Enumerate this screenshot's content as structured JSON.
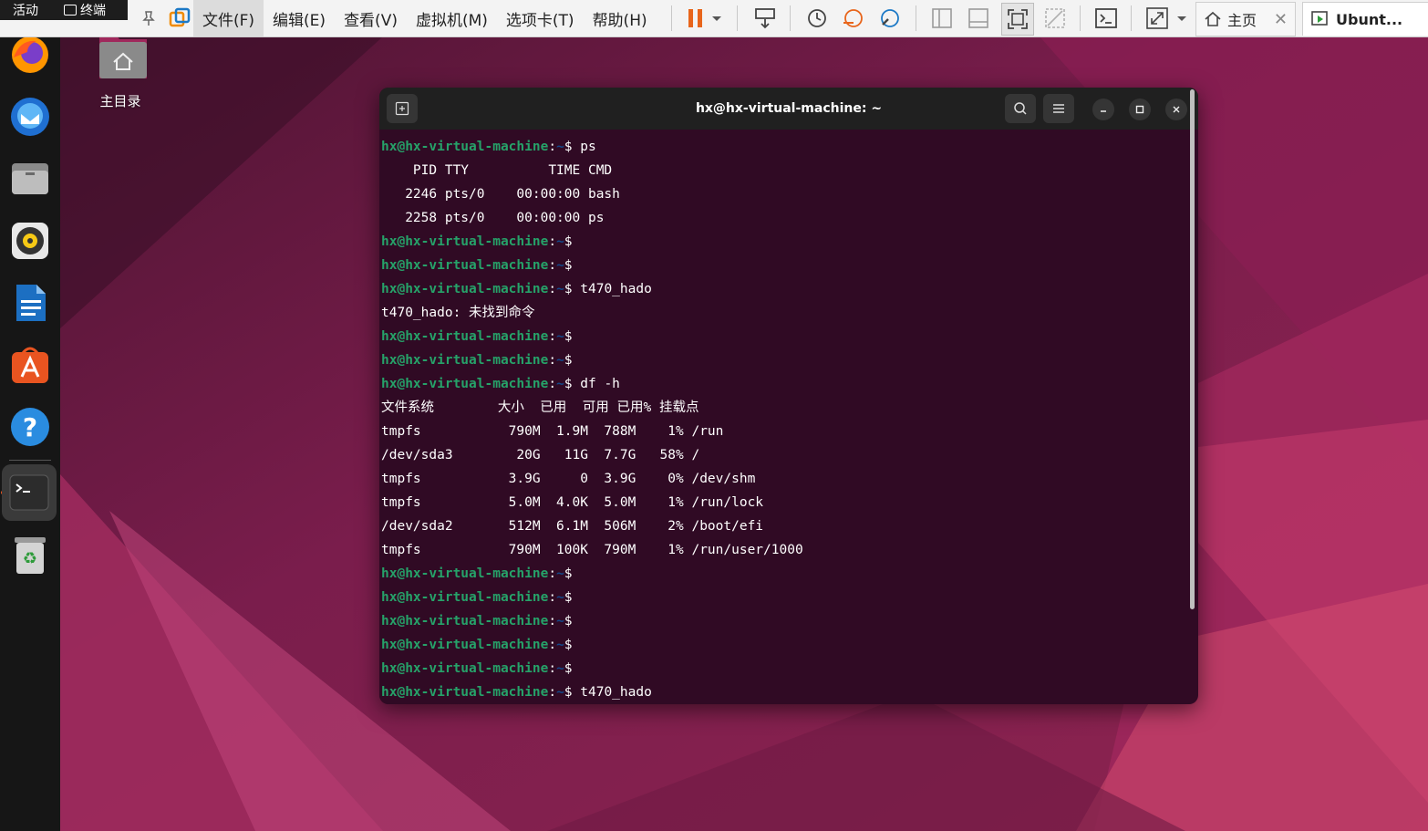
{
  "gnome_bar": {
    "activities": "活动",
    "app_name": "终端"
  },
  "vmware": {
    "menus": [
      "文件(F)",
      "编辑(E)",
      "查看(V)",
      "虚拟机(M)",
      "选项卡(T)",
      "帮助(H)"
    ],
    "tabs": [
      {
        "label": "主页",
        "icon": "home-icon",
        "closable": true
      },
      {
        "label": "Ubunt...",
        "icon": "vm-icon",
        "active": true
      }
    ],
    "pause_color": "#e8651b"
  },
  "desktop": {
    "home_folder_label": "主目录"
  },
  "dock": {
    "items": [
      "firefox",
      "thunderbird",
      "files",
      "rhythmbox",
      "libreoffice-writer",
      "app-center",
      "help",
      "terminal",
      "trash"
    ],
    "active": "terminal"
  },
  "terminal": {
    "title": "hx@hx-virtual-machine: ~",
    "prompt_user": "hx@hx-virtual-machine",
    "prompt_sep": ":",
    "prompt_path": "~",
    "prompt_symbol": "$",
    "lines": [
      {
        "type": "prompt",
        "cmd": " ps"
      },
      {
        "type": "out",
        "text": "    PID TTY          TIME CMD"
      },
      {
        "type": "out",
        "text": "   2246 pts/0    00:00:00 bash"
      },
      {
        "type": "out",
        "text": "   2258 pts/0    00:00:00 ps"
      },
      {
        "type": "prompt",
        "cmd": ""
      },
      {
        "type": "prompt",
        "cmd": ""
      },
      {
        "type": "prompt",
        "cmd": " t470_hado"
      },
      {
        "type": "out",
        "text": "t470_hado: 未找到命令"
      },
      {
        "type": "prompt",
        "cmd": ""
      },
      {
        "type": "prompt",
        "cmd": ""
      },
      {
        "type": "prompt",
        "cmd": " df -h"
      },
      {
        "type": "out",
        "text": "文件系统        大小  已用  可用 已用% 挂载点"
      },
      {
        "type": "out",
        "text": "tmpfs           790M  1.9M  788M    1% /run"
      },
      {
        "type": "out",
        "text": "/dev/sda3        20G   11G  7.7G   58% /"
      },
      {
        "type": "out",
        "text": "tmpfs           3.9G     0  3.9G    0% /dev/shm"
      },
      {
        "type": "out",
        "text": "tmpfs           5.0M  4.0K  5.0M    1% /run/lock"
      },
      {
        "type": "out",
        "text": "/dev/sda2       512M  6.1M  506M    2% /boot/efi"
      },
      {
        "type": "out",
        "text": "tmpfs           790M  100K  790M    1% /run/user/1000"
      },
      {
        "type": "prompt",
        "cmd": ""
      },
      {
        "type": "prompt",
        "cmd": ""
      },
      {
        "type": "prompt",
        "cmd": ""
      },
      {
        "type": "prompt",
        "cmd": ""
      },
      {
        "type": "prompt",
        "cmd": ""
      },
      {
        "type": "prompt",
        "cmd": " t470_hado"
      }
    ]
  }
}
